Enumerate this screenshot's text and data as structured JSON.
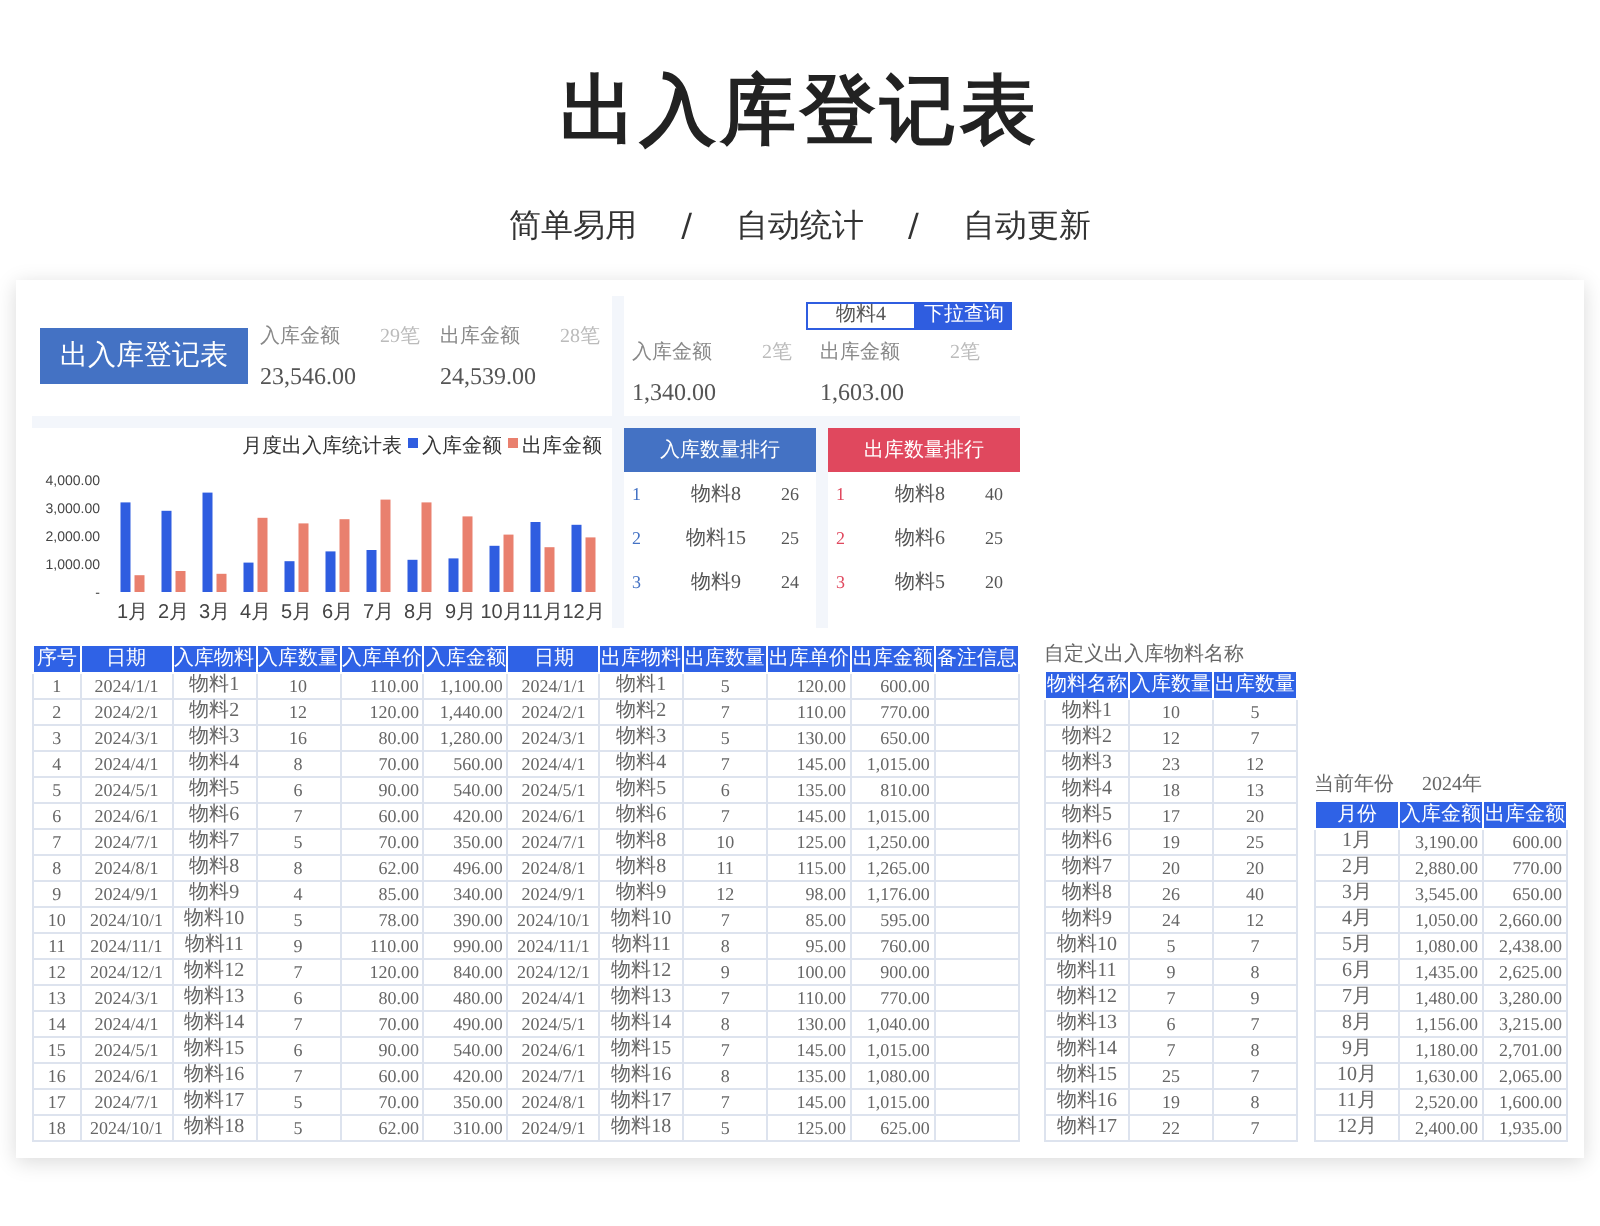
{
  "header": {
    "title": "出入库登记表",
    "subtitle": [
      "简单易用",
      "/",
      "自动统计",
      "/",
      "自动更新"
    ]
  },
  "sheet": {
    "banner": "出入库登记表",
    "totals": [
      {
        "label": "入库金额",
        "count": "29笔",
        "value": "23,546.00"
      },
      {
        "label": "出库金额",
        "count": "28笔",
        "value": "24,539.00"
      }
    ],
    "filter": {
      "value": "物料4",
      "button": "下拉查询"
    },
    "filtered_totals": [
      {
        "label": "入库金额",
        "count": "2笔",
        "value": "1,340.00"
      },
      {
        "label": "出库金额",
        "count": "2笔",
        "value": "1,603.00"
      }
    ],
    "chart": {
      "chart_data": {
        "type": "bar",
        "title": "月度出入库统计表",
        "categories": [
          "1月",
          "2月",
          "3月",
          "4月",
          "5月",
          "6月",
          "7月",
          "8月",
          "9月",
          "10月",
          "11月",
          "12月"
        ],
        "series": [
          {
            "name": "入库金额",
            "color": "#2f5de0",
            "values": [
              3200,
              2900,
              3550,
              1050,
              1100,
              1450,
              1500,
              1150,
              1200,
              1650,
              2500,
              2400
            ]
          },
          {
            "name": "出库金额",
            "color": "#e9806e",
            "values": [
              600,
              750,
              650,
              2650,
              2450,
              2600,
              3300,
              3200,
              2700,
              2050,
              1600,
              1950
            ]
          }
        ],
        "legend": "top-right",
        "ylim": [
          0,
          4000
        ],
        "yticks": [
          {
            "value": 0,
            "label": "-"
          },
          {
            "value": 1000,
            "label": "1,000.00"
          },
          {
            "value": 2000,
            "label": "2,000.00"
          },
          {
            "value": 3000,
            "label": "3,000.00"
          },
          {
            "value": 4000,
            "label": "4,000.00"
          }
        ]
      }
    },
    "rankings": [
      {
        "title": "入库数量排行",
        "color": "#4472c4",
        "rows": [
          {
            "rank": "1",
            "item": "物料8",
            "qty": "26"
          },
          {
            "rank": "2",
            "item": "物料15",
            "qty": "25"
          },
          {
            "rank": "3",
            "item": "物料9",
            "qty": "24"
          }
        ]
      },
      {
        "title": "出库数量排行",
        "color": "#e0485e",
        "rows": [
          {
            "rank": "1",
            "item": "物料8",
            "qty": "40"
          },
          {
            "rank": "2",
            "item": "物料6",
            "qty": "25"
          },
          {
            "rank": "3",
            "item": "物料5",
            "qty": "20"
          }
        ]
      }
    ],
    "ledger": {
      "columns": [
        "序号",
        "日期",
        "入库物料",
        "入库数量",
        "入库单价",
        "入库金额",
        "日期",
        "出库物料",
        "出库数量",
        "出库单价",
        "出库金额",
        "备注信息"
      ],
      "rows": [
        [
          "1",
          "2024/1/1",
          "物料1",
          "10",
          "110.00",
          "1,100.00",
          "2024/1/1",
          "物料1",
          "5",
          "120.00",
          "600.00"
        ],
        [
          "2",
          "2024/2/1",
          "物料2",
          "12",
          "120.00",
          "1,440.00",
          "2024/2/1",
          "物料2",
          "7",
          "110.00",
          "770.00"
        ],
        [
          "3",
          "2024/3/1",
          "物料3",
          "16",
          "80.00",
          "1,280.00",
          "2024/3/1",
          "物料3",
          "5",
          "130.00",
          "650.00"
        ],
        [
          "4",
          "2024/4/1",
          "物料4",
          "8",
          "70.00",
          "560.00",
          "2024/4/1",
          "物料4",
          "7",
          "145.00",
          "1,015.00"
        ],
        [
          "5",
          "2024/5/1",
          "物料5",
          "6",
          "90.00",
          "540.00",
          "2024/5/1",
          "物料5",
          "6",
          "135.00",
          "810.00"
        ],
        [
          "6",
          "2024/6/1",
          "物料6",
          "7",
          "60.00",
          "420.00",
          "2024/6/1",
          "物料6",
          "7",
          "145.00",
          "1,015.00"
        ],
        [
          "7",
          "2024/7/1",
          "物料7",
          "5",
          "70.00",
          "350.00",
          "2024/7/1",
          "物料8",
          "10",
          "125.00",
          "1,250.00"
        ],
        [
          "8",
          "2024/8/1",
          "物料8",
          "8",
          "62.00",
          "496.00",
          "2024/8/1",
          "物料8",
          "11",
          "115.00",
          "1,265.00"
        ],
        [
          "9",
          "2024/9/1",
          "物料9",
          "4",
          "85.00",
          "340.00",
          "2024/9/1",
          "物料9",
          "12",
          "98.00",
          "1,176.00"
        ],
        [
          "10",
          "2024/10/1",
          "物料10",
          "5",
          "78.00",
          "390.00",
          "2024/10/1",
          "物料10",
          "7",
          "85.00",
          "595.00"
        ],
        [
          "11",
          "2024/11/1",
          "物料11",
          "9",
          "110.00",
          "990.00",
          "2024/11/1",
          "物料11",
          "8",
          "95.00",
          "760.00"
        ],
        [
          "12",
          "2024/12/1",
          "物料12",
          "7",
          "120.00",
          "840.00",
          "2024/12/1",
          "物料12",
          "9",
          "100.00",
          "900.00"
        ],
        [
          "13",
          "2024/3/1",
          "物料13",
          "6",
          "80.00",
          "480.00",
          "2024/4/1",
          "物料13",
          "7",
          "110.00",
          "770.00"
        ],
        [
          "14",
          "2024/4/1",
          "物料14",
          "7",
          "70.00",
          "490.00",
          "2024/5/1",
          "物料14",
          "8",
          "130.00",
          "1,040.00"
        ],
        [
          "15",
          "2024/5/1",
          "物料15",
          "6",
          "90.00",
          "540.00",
          "2024/6/1",
          "物料15",
          "7",
          "145.00",
          "1,015.00"
        ],
        [
          "16",
          "2024/6/1",
          "物料16",
          "7",
          "60.00",
          "420.00",
          "2024/7/1",
          "物料16",
          "8",
          "135.00",
          "1,080.00"
        ],
        [
          "17",
          "2024/7/1",
          "物料17",
          "5",
          "70.00",
          "350.00",
          "2024/8/1",
          "物料17",
          "7",
          "145.00",
          "1,015.00"
        ],
        [
          "18",
          "2024/10/1",
          "物料18",
          "5",
          "62.00",
          "310.00",
          "2024/9/1",
          "物料18",
          "5",
          "125.00",
          "625.00"
        ]
      ]
    },
    "material_summary": {
      "title": "自定义出入库物料名称",
      "columns": [
        "物料名称",
        "入库数量",
        "出库数量"
      ],
      "rows": [
        [
          "物料1",
          "10",
          "5"
        ],
        [
          "物料2",
          "12",
          "7"
        ],
        [
          "物料3",
          "23",
          "12"
        ],
        [
          "物料4",
          "18",
          "13"
        ],
        [
          "物料5",
          "17",
          "20"
        ],
        [
          "物料6",
          "19",
          "25"
        ],
        [
          "物料7",
          "20",
          "20"
        ],
        [
          "物料8",
          "26",
          "40"
        ],
        [
          "物料9",
          "24",
          "12"
        ],
        [
          "物料10",
          "5",
          "7"
        ],
        [
          "物料11",
          "9",
          "8"
        ],
        [
          "物料12",
          "7",
          "9"
        ],
        [
          "物料13",
          "6",
          "7"
        ],
        [
          "物料14",
          "7",
          "8"
        ],
        [
          "物料15",
          "25",
          "7"
        ],
        [
          "物料16",
          "19",
          "8"
        ],
        [
          "物料17",
          "22",
          "7"
        ]
      ]
    },
    "monthly_summary": {
      "label": "当前年份",
      "year": "2024年",
      "columns": [
        "月份",
        "入库金额",
        "出库金额"
      ],
      "rows": [
        [
          "1月",
          "3,190.00",
          "600.00"
        ],
        [
          "2月",
          "2,880.00",
          "770.00"
        ],
        [
          "3月",
          "3,545.00",
          "650.00"
        ],
        [
          "4月",
          "1,050.00",
          "2,660.00"
        ],
        [
          "5月",
          "1,080.00",
          "2,438.00"
        ],
        [
          "6月",
          "1,435.00",
          "2,625.00"
        ],
        [
          "7月",
          "1,480.00",
          "3,280.00"
        ],
        [
          "8月",
          "1,156.00",
          "3,215.00"
        ],
        [
          "9月",
          "1,180.00",
          "2,701.00"
        ],
        [
          "10月",
          "1,630.00",
          "2,065.00"
        ],
        [
          "11月",
          "2,520.00",
          "1,600.00"
        ],
        [
          "12月",
          "2,400.00",
          "1,935.00"
        ]
      ]
    }
  }
}
